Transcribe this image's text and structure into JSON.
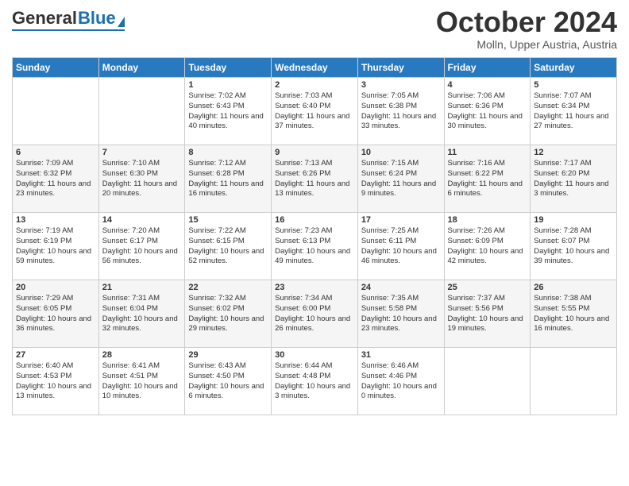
{
  "header": {
    "logo_general": "General",
    "logo_blue": "Blue",
    "month": "October 2024",
    "location": "Molln, Upper Austria, Austria"
  },
  "days_of_week": [
    "Sunday",
    "Monday",
    "Tuesday",
    "Wednesday",
    "Thursday",
    "Friday",
    "Saturday"
  ],
  "weeks": [
    [
      {
        "day": "",
        "content": ""
      },
      {
        "day": "",
        "content": ""
      },
      {
        "day": "1",
        "content": "Sunrise: 7:02 AM\nSunset: 6:43 PM\nDaylight: 11 hours and 40 minutes."
      },
      {
        "day": "2",
        "content": "Sunrise: 7:03 AM\nSunset: 6:40 PM\nDaylight: 11 hours and 37 minutes."
      },
      {
        "day": "3",
        "content": "Sunrise: 7:05 AM\nSunset: 6:38 PM\nDaylight: 11 hours and 33 minutes."
      },
      {
        "day": "4",
        "content": "Sunrise: 7:06 AM\nSunset: 6:36 PM\nDaylight: 11 hours and 30 minutes."
      },
      {
        "day": "5",
        "content": "Sunrise: 7:07 AM\nSunset: 6:34 PM\nDaylight: 11 hours and 27 minutes."
      }
    ],
    [
      {
        "day": "6",
        "content": "Sunrise: 7:09 AM\nSunset: 6:32 PM\nDaylight: 11 hours and 23 minutes."
      },
      {
        "day": "7",
        "content": "Sunrise: 7:10 AM\nSunset: 6:30 PM\nDaylight: 11 hours and 20 minutes."
      },
      {
        "day": "8",
        "content": "Sunrise: 7:12 AM\nSunset: 6:28 PM\nDaylight: 11 hours and 16 minutes."
      },
      {
        "day": "9",
        "content": "Sunrise: 7:13 AM\nSunset: 6:26 PM\nDaylight: 11 hours and 13 minutes."
      },
      {
        "day": "10",
        "content": "Sunrise: 7:15 AM\nSunset: 6:24 PM\nDaylight: 11 hours and 9 minutes."
      },
      {
        "day": "11",
        "content": "Sunrise: 7:16 AM\nSunset: 6:22 PM\nDaylight: 11 hours and 6 minutes."
      },
      {
        "day": "12",
        "content": "Sunrise: 7:17 AM\nSunset: 6:20 PM\nDaylight: 11 hours and 3 minutes."
      }
    ],
    [
      {
        "day": "13",
        "content": "Sunrise: 7:19 AM\nSunset: 6:19 PM\nDaylight: 10 hours and 59 minutes."
      },
      {
        "day": "14",
        "content": "Sunrise: 7:20 AM\nSunset: 6:17 PM\nDaylight: 10 hours and 56 minutes."
      },
      {
        "day": "15",
        "content": "Sunrise: 7:22 AM\nSunset: 6:15 PM\nDaylight: 10 hours and 52 minutes."
      },
      {
        "day": "16",
        "content": "Sunrise: 7:23 AM\nSunset: 6:13 PM\nDaylight: 10 hours and 49 minutes."
      },
      {
        "day": "17",
        "content": "Sunrise: 7:25 AM\nSunset: 6:11 PM\nDaylight: 10 hours and 46 minutes."
      },
      {
        "day": "18",
        "content": "Sunrise: 7:26 AM\nSunset: 6:09 PM\nDaylight: 10 hours and 42 minutes."
      },
      {
        "day": "19",
        "content": "Sunrise: 7:28 AM\nSunset: 6:07 PM\nDaylight: 10 hours and 39 minutes."
      }
    ],
    [
      {
        "day": "20",
        "content": "Sunrise: 7:29 AM\nSunset: 6:05 PM\nDaylight: 10 hours and 36 minutes."
      },
      {
        "day": "21",
        "content": "Sunrise: 7:31 AM\nSunset: 6:04 PM\nDaylight: 10 hours and 32 minutes."
      },
      {
        "day": "22",
        "content": "Sunrise: 7:32 AM\nSunset: 6:02 PM\nDaylight: 10 hours and 29 minutes."
      },
      {
        "day": "23",
        "content": "Sunrise: 7:34 AM\nSunset: 6:00 PM\nDaylight: 10 hours and 26 minutes."
      },
      {
        "day": "24",
        "content": "Sunrise: 7:35 AM\nSunset: 5:58 PM\nDaylight: 10 hours and 23 minutes."
      },
      {
        "day": "25",
        "content": "Sunrise: 7:37 AM\nSunset: 5:56 PM\nDaylight: 10 hours and 19 minutes."
      },
      {
        "day": "26",
        "content": "Sunrise: 7:38 AM\nSunset: 5:55 PM\nDaylight: 10 hours and 16 minutes."
      }
    ],
    [
      {
        "day": "27",
        "content": "Sunrise: 6:40 AM\nSunset: 4:53 PM\nDaylight: 10 hours and 13 minutes."
      },
      {
        "day": "28",
        "content": "Sunrise: 6:41 AM\nSunset: 4:51 PM\nDaylight: 10 hours and 10 minutes."
      },
      {
        "day": "29",
        "content": "Sunrise: 6:43 AM\nSunset: 4:50 PM\nDaylight: 10 hours and 6 minutes."
      },
      {
        "day": "30",
        "content": "Sunrise: 6:44 AM\nSunset: 4:48 PM\nDaylight: 10 hours and 3 minutes."
      },
      {
        "day": "31",
        "content": "Sunrise: 6:46 AM\nSunset: 4:46 PM\nDaylight: 10 hours and 0 minutes."
      },
      {
        "day": "",
        "content": ""
      },
      {
        "day": "",
        "content": ""
      }
    ]
  ]
}
